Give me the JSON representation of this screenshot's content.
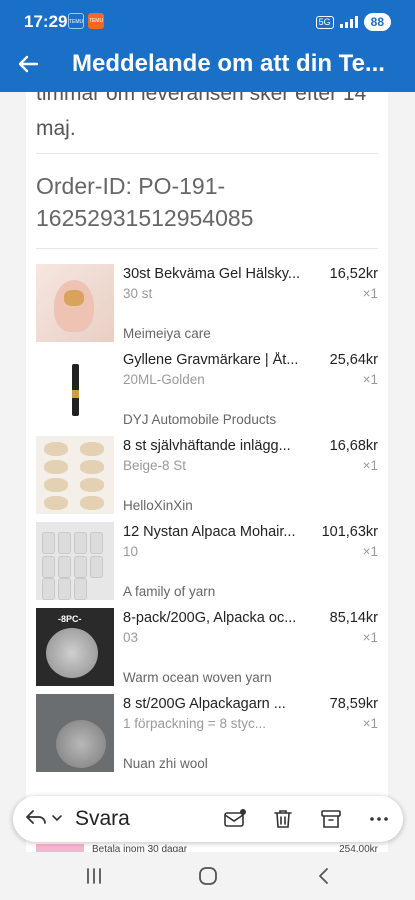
{
  "status_bar": {
    "time": "17:29",
    "app_icon_1": "TEMU",
    "app_icon_2": "TEMU",
    "network": "5G",
    "battery": "88"
  },
  "app_bar": {
    "back_icon": "arrow-left-icon",
    "title": "Meddelande om att din Te..."
  },
  "email": {
    "intro_text": "timmar om leveransen sker efter 14 maj.",
    "order_id": "Order-ID: PO-191-16252931512954085",
    "items": [
      {
        "name": "30st Bekväma Gel Hälsky...",
        "price": "16,52kr",
        "variant": "30 st",
        "qty": "×1",
        "seller": "Meimeiya care"
      },
      {
        "name": "Gyllene Gravmärkare | Åt...",
        "price": "25,64kr",
        "variant": "20ML-Golden",
        "qty": "×1",
        "seller": "DYJ Automobile Products"
      },
      {
        "name": "8 st självhäftande inlägg...",
        "price": "16,68kr",
        "variant": "Beige-8 St",
        "qty": "×1",
        "seller": "HelloXinXin"
      },
      {
        "name": "12 Nystan Alpaca Mohair...",
        "price": "101,63kr",
        "variant": "10",
        "qty": "×1",
        "seller": "A family of yarn"
      },
      {
        "name": "8-pack/200G, Alpacka oc...",
        "price": "85,14kr",
        "variant": "03",
        "qty": "×1",
        "seller": "Warm ocean woven yarn"
      },
      {
        "name": "8 st/200G Alpackagarn ...",
        "price": "78,59kr",
        "variant": "1 förpackning = 8 styc...",
        "qty": "×1",
        "seller": "Nuan zhi wool"
      }
    ],
    "peek_row": {
      "text": "Betala inom 30 dagar",
      "value": "254,00kr"
    }
  },
  "reply_bar": {
    "reply_label": "Svara",
    "icons": [
      "reply-icon",
      "chevron-down-icon",
      "mark-unread-icon",
      "trash-icon",
      "archive-icon",
      "more-icon"
    ]
  },
  "nav_bar": {
    "icons": [
      "recents-icon",
      "home-icon",
      "back-icon"
    ]
  },
  "colors": {
    "app_bar": "#1a6fc7",
    "text": "#222222",
    "muted": "#9a9a9a"
  }
}
